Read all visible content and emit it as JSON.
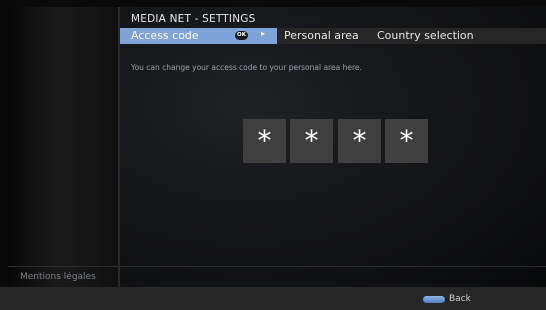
{
  "header": {
    "title": "MEDIA NET - SETTINGS"
  },
  "tabs": [
    {
      "label": "Access code",
      "active": true
    },
    {
      "label": "Personal area",
      "active": false
    },
    {
      "label": "Country selection",
      "active": false
    }
  ],
  "ok_button": {
    "label": "OK",
    "icon": "ok-key-icon"
  },
  "arrow": {
    "icon": "right-arrow-icon",
    "glyph": "▸"
  },
  "description": "You can change your access code to your personal area here.",
  "pin": {
    "digits": [
      "*",
      "*",
      "*",
      "*"
    ]
  },
  "sidebar": {
    "legal_label": "Mentions légales"
  },
  "footer": {
    "back_label": "Back",
    "back_key_color": "#6f9ad6"
  },
  "colors": {
    "accent": "#7ea3d8",
    "background": "#0a0a0a",
    "pin_box": "#3f3f3f"
  }
}
